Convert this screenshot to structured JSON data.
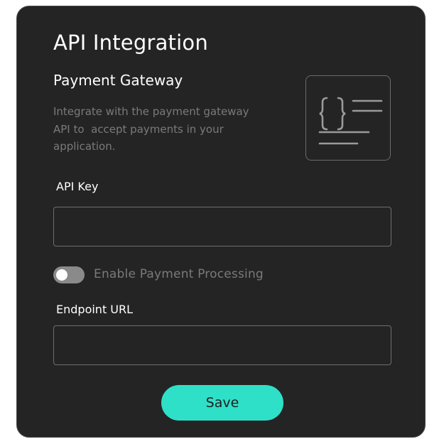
{
  "card": {
    "title": "API Integration",
    "subtitle": "Payment Gateway",
    "description": "Integrate with the payment gateway\nAPI to  accept payments in your\napplication.",
    "illustration_icon": "code-braces-icon"
  },
  "fields": {
    "api_key": {
      "label": "API Key",
      "value": "",
      "placeholder": ""
    },
    "endpoint_url": {
      "label": "Endpoint URL",
      "value": "",
      "placeholder": ""
    }
  },
  "toggle": {
    "label": "Enable Payment Processing",
    "enabled": false
  },
  "actions": {
    "save_label": "Save"
  },
  "colors": {
    "card_background": "#242424",
    "accent": "#2fe0c8",
    "muted_text": "#7a7a7a",
    "toggle_off": "#8a8a8a"
  }
}
